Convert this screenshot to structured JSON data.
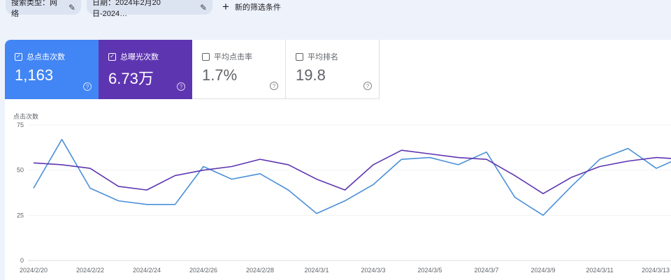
{
  "filters": {
    "search_type": "搜索类型：网络",
    "date": "日期：2024年2月20日-2024…",
    "add_filter": "新的筛选条件"
  },
  "metrics": [
    {
      "label": "总点击次数",
      "value": "1,163",
      "checked": true,
      "color": "#4285f4"
    },
    {
      "label": "总曝光次数",
      "value": "6.73万",
      "checked": true,
      "color": "#5e35b1"
    },
    {
      "label": "平均点击率",
      "value": "1.7%",
      "checked": false
    },
    {
      "label": "平均排名",
      "value": "19.8",
      "checked": false
    }
  ],
  "chart_data": {
    "type": "line",
    "ylabel": "点击次数",
    "ylim": [
      0,
      75
    ],
    "yticks": [
      "0",
      "25",
      "50",
      "75"
    ],
    "grid": true,
    "x": [
      "2024/2/20",
      "2024/2/21",
      "2024/2/22",
      "2024/2/23",
      "2024/2/24",
      "2024/2/25",
      "2024/2/26",
      "2024/2/27",
      "2024/2/28",
      "2024/2/29",
      "2024/3/1",
      "2024/3/2",
      "2024/3/3",
      "2024/3/4",
      "2024/3/5",
      "2024/3/6",
      "2024/3/7",
      "2024/3/8",
      "2024/3/9",
      "2024/3/10",
      "2024/3/11",
      "2024/3/12",
      "2024/3/13",
      "2024/3/14"
    ],
    "xtick_labels": [
      "2024/2/20",
      "2024/2/22",
      "2024/2/24",
      "2024/2/26",
      "2024/2/28",
      "2024/3/1",
      "2024/3/3",
      "2024/3/5",
      "2024/3/7",
      "2024/3/9",
      "2024/3/11",
      "2024/3/13"
    ],
    "series": [
      {
        "color": "#4a90d9",
        "values": [
          40,
          67,
          40,
          33,
          31,
          31,
          52,
          45,
          48,
          39,
          26,
          33,
          42,
          56,
          57,
          53,
          60,
          35,
          25,
          41,
          56,
          62,
          51,
          58
        ]
      },
      {
        "color": "#5e35b1",
        "values": [
          54,
          53,
          51,
          41,
          39,
          47,
          50,
          52,
          56,
          53,
          45,
          39,
          53,
          61,
          59,
          57,
          56,
          47,
          37,
          46,
          52,
          55,
          57,
          56
        ]
      }
    ]
  }
}
